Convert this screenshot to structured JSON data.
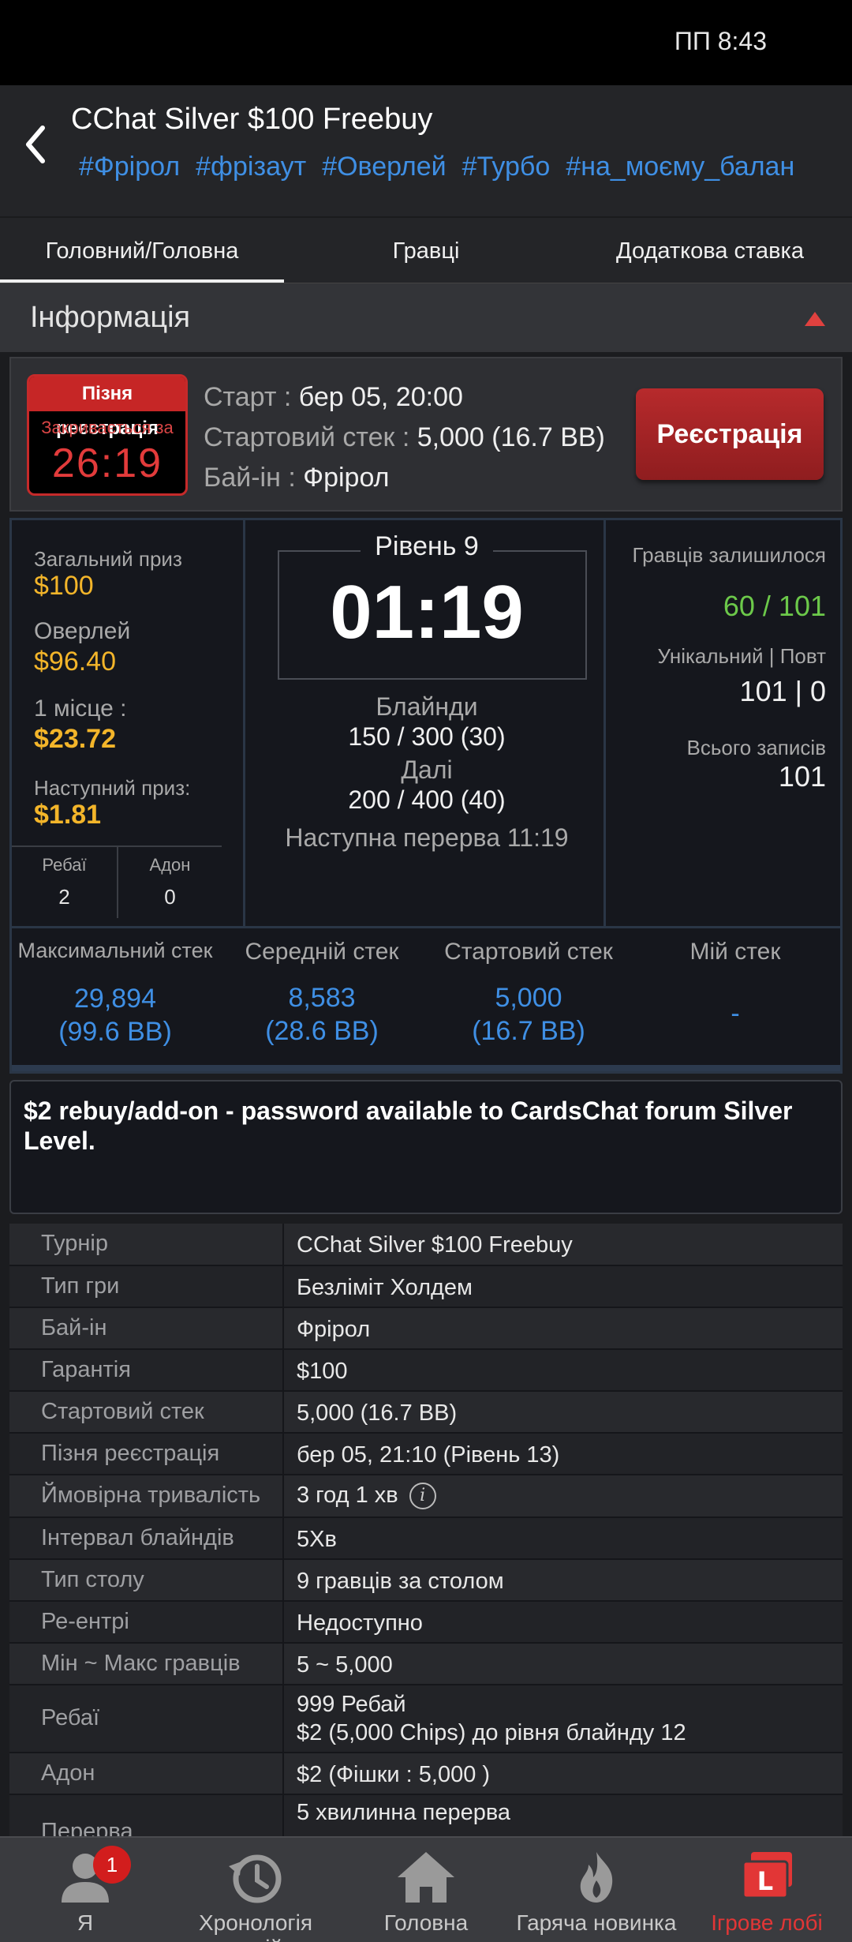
{
  "status": {
    "time": "ПП 8:43"
  },
  "header": {
    "title": "CChat Silver $100 Freebuy",
    "tags": [
      "#Фрірол",
      "#фрізаут",
      "#Оверлей",
      "#Турбо",
      "#на_моєму_балан"
    ]
  },
  "tabs": [
    "Головний/Головна",
    "Гравці",
    "Додаткова ставка"
  ],
  "section": {
    "title": "Інформація"
  },
  "registration": {
    "late_title": "Пізня реєстрація",
    "late_sub": "Закривається за",
    "late_timer": "26:19",
    "start_label": "Старт : ",
    "start_value": "бер 05, 20:00",
    "stack_label": "Стартовий стек : ",
    "stack_value": "5,000 (16.7 BB)",
    "buyin_label": "Бай-ін : ",
    "buyin_value": "Фрірол",
    "button": "Реєстрація"
  },
  "stats": {
    "total_prize_label": "Загальний приз",
    "total_prize": "$100",
    "overlay_label": "Оверлей",
    "overlay": "$96.40",
    "first_place_label": "1 місце :",
    "first_place": "$23.72",
    "next_prize_label": "Наступний приз:",
    "next_prize": "$1.81",
    "rebuy_label": "Ребаї",
    "rebuy": "2",
    "addon_label": "Адон",
    "addon": "0",
    "level": "Рівень 9",
    "clock": "01:19",
    "blinds_label": "Блайнди",
    "blinds": "150 / 300 (30)",
    "next_label": "Далі",
    "next_blinds": "200 / 400 (40)",
    "next_break": "Наступна перерва 11:19",
    "players_left_label": "Гравців залишилося",
    "players_left": "60 / 101",
    "unique_label": "Унікальний | Повт",
    "unique": "101 | 0",
    "total_entries_label": "Всього записів",
    "total_entries": "101"
  },
  "stacks": [
    {
      "label": "Максимальний стек",
      "value": "29,894",
      "bb": "(99.6 BB)"
    },
    {
      "label": "Середній стек",
      "value": "8,583",
      "bb": "(28.6 BB)"
    },
    {
      "label": "Стартовий стек",
      "value": "5,000",
      "bb": "(16.7 BB)"
    },
    {
      "label": "Мій стек",
      "value": "-",
      "bb": ""
    }
  ],
  "notice": "$2 rebuy/add-on - password available to CardsChat forum Silver Level.",
  "details": [
    {
      "key": "Турнір",
      "value": "CChat Silver $100 Freebuy"
    },
    {
      "key": "Тип гри",
      "value": "Безліміт Холдем"
    },
    {
      "key": "Бай-ін",
      "value": "Фрірол"
    },
    {
      "key": "Гарантія",
      "value": "$100"
    },
    {
      "key": "Стартовий стек",
      "value": "5,000 (16.7 BB)"
    },
    {
      "key": "Пізня реєстрація",
      "value": "бер 05, 21:10 (Рівень 13)"
    },
    {
      "key": "Ймовірна тривалість",
      "value": "3 год 1 хв"
    },
    {
      "key": "Інтервал блайндів",
      "value": "5Хв"
    },
    {
      "key": "Тип столу",
      "value": "9 гравців за столом"
    },
    {
      "key": "Ре-ентрі",
      "value": "Недоступно"
    },
    {
      "key": "Мін ~ Макс гравців",
      "value": "5 ~ 5,000"
    },
    {
      "key": "Ребаї",
      "value": "999 Ребай",
      "value2": "$2 (5,000 Chips) до рівня блайнду 12"
    },
    {
      "key": "Адон",
      "value": "$2 (Фішки : 5,000 )"
    },
    {
      "key": "Перерва",
      "value": "5 хвилинна перерва"
    }
  ],
  "nav": {
    "badge": "1",
    "items": [
      "Я",
      "Хронологія подій",
      "Головна",
      "Гаряча новинка",
      "Ігрове лобі"
    ]
  },
  "colors": {
    "accent_blue": "#3f8fe4",
    "gold": "#f3b52a",
    "green": "#6cc94a",
    "red": "#c62626"
  }
}
